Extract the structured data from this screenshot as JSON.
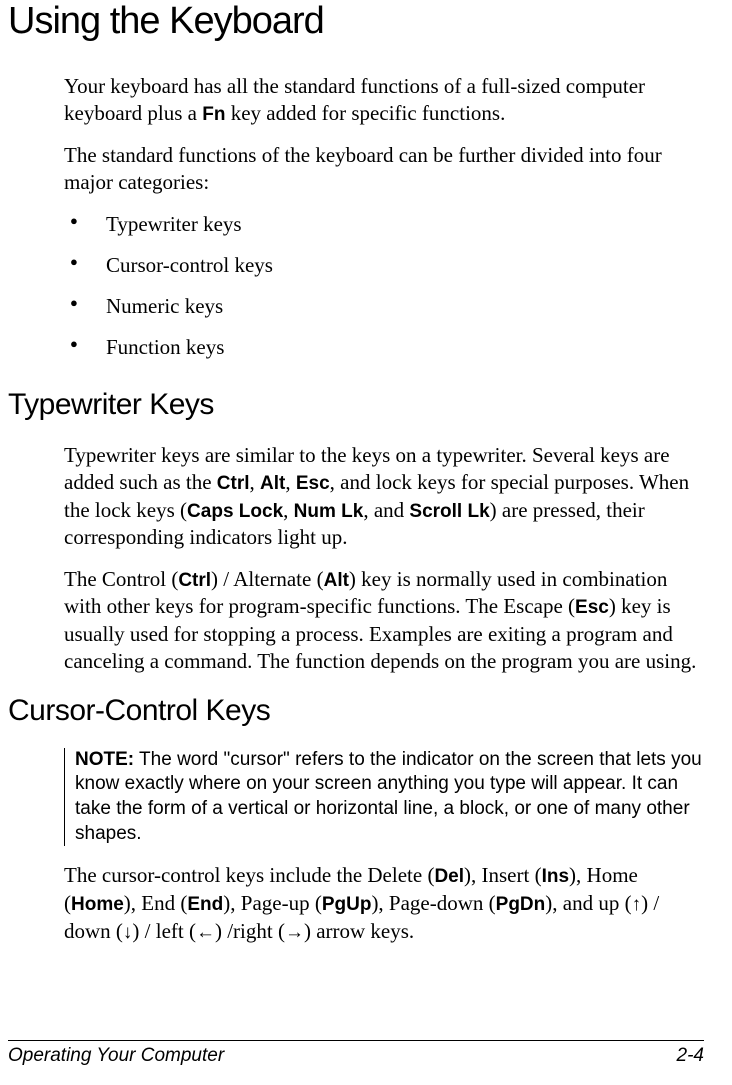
{
  "title": "Using the Keyboard",
  "intro1_a": "Your keyboard has all the standard functions of a full-sized computer keyboard plus a ",
  "intro1_key": "Fn",
  "intro1_b": " key added for specific functions.",
  "intro2": "The standard functions of the keyboard can be further divided into four major categories:",
  "bullets": [
    "Typewriter keys",
    "Cursor-control keys",
    "Numeric keys",
    "Function keys"
  ],
  "sec1_title": "Typewriter Keys",
  "sec1_p1": {
    "a": "Typewriter keys are similar to the keys on a typewriter. Several keys are added such as the ",
    "k1": "Ctrl",
    "c1": ", ",
    "k2": "Alt",
    "c2": ", ",
    "k3": "Esc",
    "b": ", and lock keys for special purposes. When the lock keys (",
    "k4": "Caps Lock",
    "c3": ", ",
    "k5": "Num Lk",
    "c4": ", and ",
    "k6": "Scroll Lk",
    "c": ") are pressed, their corresponding indicators light up."
  },
  "sec1_p2": {
    "a": "The Control (",
    "k1": "Ctrl",
    "b": ") / Alternate (",
    "k2": "Alt",
    "c": ") key is normally used in combination with other keys for program-specific functions. The Escape (",
    "k3": "Esc",
    "d": ") key is usually used for stopping a process. Examples are exiting a program and canceling a command. The function depends on the program you are using."
  },
  "sec2_title": "Cursor-Control Keys",
  "note": {
    "label": "NOTE:",
    "text": " The word \"cursor\" refers to the indicator on the screen that lets you know exactly where on your screen anything you type will appear. It can take the form of a vertical or horizontal line, a block, or one of many other shapes."
  },
  "sec2_p1": {
    "a": "The cursor-control keys include the Delete (",
    "k1": "Del",
    "b": "), Insert (",
    "k2": "Ins",
    "c": "), Home (",
    "k3": "Home",
    "d": "), End (",
    "k4": "End",
    "e": "), Page-up (",
    "k5": "PgUp",
    "f": "), Page-down (",
    "k6": "PgDn",
    "g": "), and up (",
    "ar1": "↑",
    "h": ") / down (",
    "ar2": "↓",
    "i": ") / left (",
    "ar3": "←",
    "j": ") /right (",
    "ar4": "→",
    "k": ") arrow keys."
  },
  "footer_left": "Operating Your Computer",
  "footer_right": "2-4"
}
